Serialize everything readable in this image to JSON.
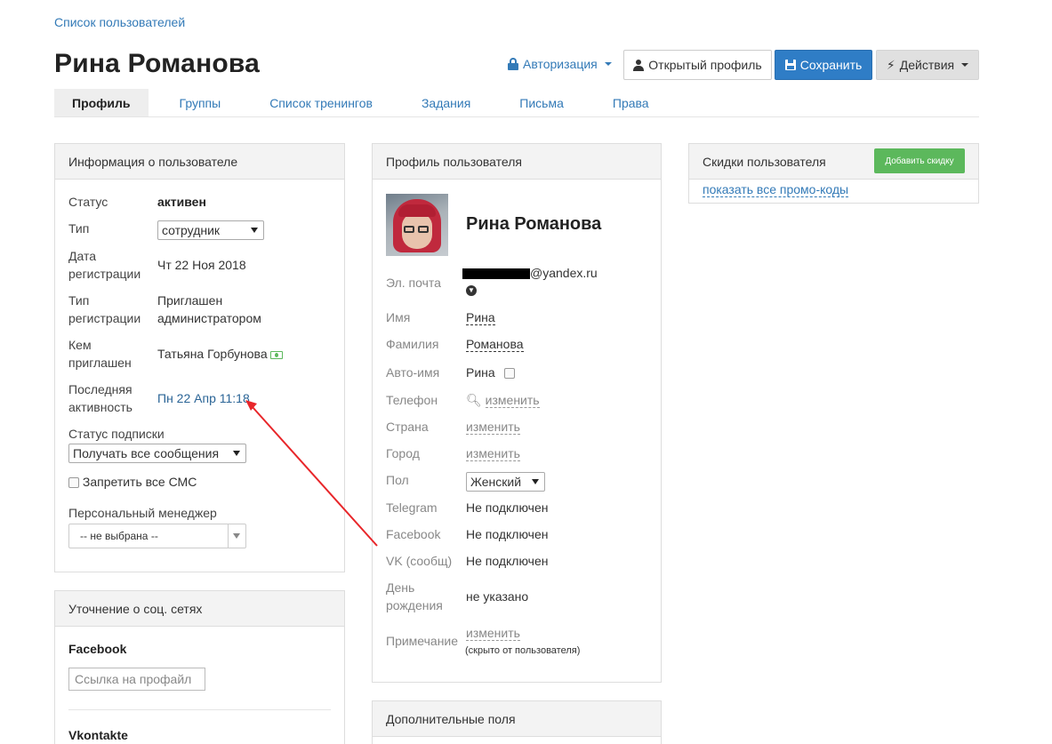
{
  "breadcrumb": "Список пользователей",
  "title": "Рина Романова",
  "header": {
    "auth_label": "Авторизация",
    "open_profile": "Открытый профиль",
    "save": "Сохранить",
    "actions": "Действия",
    "accent": "#2f7dc6"
  },
  "tabs": [
    "Профиль",
    "Группы",
    "Список тренингов",
    "Задания",
    "Письма",
    "Права"
  ],
  "user_info": {
    "heading": "Информация о пользователе",
    "status_label": "Статус",
    "status_value": "активен",
    "type_label": "Тип",
    "type_value": "сотрудник",
    "reg_date_label_1": "Дата",
    "reg_date_label_2": "регистрации",
    "reg_date_value": "Чт 22 Ноя 2018",
    "reg_type_label_1": "Тип",
    "reg_type_label_2": "регистрации",
    "reg_type_value_1": "Приглашен",
    "reg_type_value_2": "администратором",
    "invited_by_label_1": "Кем",
    "invited_by_label_2": "приглашен",
    "invited_by_value": "Татьяна Горбунова",
    "last_activity_label_1": "Последняя",
    "last_activity_label_2": "активность",
    "last_activity_value": "Пн 22 Апр 11:18",
    "subscription_label": "Статус подписки",
    "subscription_value": "Получать все сообщения",
    "no_sms_label": "Запретить все СМС",
    "manager_label": "Персональный менеджер",
    "manager_value": "-- не выбрана --"
  },
  "social": {
    "heading": "Уточнение о соц. сетях",
    "facebook_label": "Facebook",
    "facebook_placeholder": "Ссылка на профайл",
    "vk_label": "Vkontakte"
  },
  "profile": {
    "heading": "Профиль пользователя",
    "name": "Рина Романова",
    "email_label": "Эл. почта",
    "email_value": "@yandex.ru",
    "first_name_label": "Имя",
    "first_name_value": "Рина",
    "last_name_label": "Фамилия",
    "last_name_value": "Романова",
    "auto_name_label": "Авто-имя",
    "auto_name_value": "Рина",
    "phone_label": "Телефон",
    "phone_action": "изменить",
    "country_label": "Страна",
    "country_action": "изменить",
    "city_label": "Город",
    "city_action": "изменить",
    "gender_label": "Пол",
    "gender_value": "Женский",
    "telegram_label": "Telegram",
    "telegram_value": "Не подключен",
    "facebook_label": "Facebook",
    "facebook_value": "Не подключен",
    "vk_label": "VK (сообщ)",
    "vk_value": "Не подключен",
    "birthday_label_1": "День",
    "birthday_label_2": "рождения",
    "birthday_value": "не указано",
    "note_label": "Примечание",
    "note_action": "изменить",
    "note_hint": "(скрыто от пользователя)"
  },
  "extra": {
    "heading": "Дополнительные поля"
  },
  "discounts": {
    "heading": "Скидки пользователя",
    "add_button": "Добавить скидку",
    "show_promo": "показать все промо-коды"
  }
}
